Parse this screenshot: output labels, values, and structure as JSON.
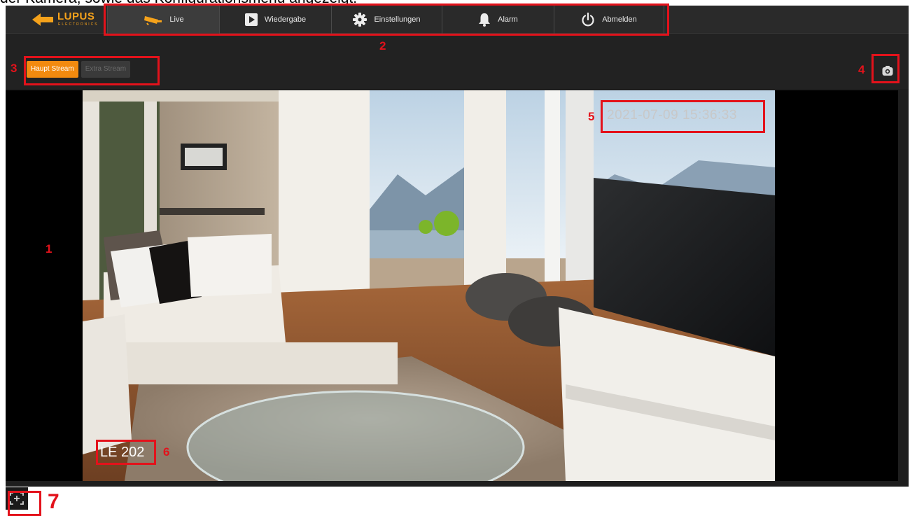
{
  "caption": "der Kamera, sowie das Konfigurationsmenü angezeigt.",
  "brand": {
    "name": "LUPUS",
    "tagline": "ELECTRONICS"
  },
  "nav": {
    "items": [
      {
        "label": "Live",
        "icon": "cctv-camera-icon",
        "active": true
      },
      {
        "label": "Wiedergabe",
        "icon": "play-icon"
      },
      {
        "label": "Einstellungen",
        "icon": "gear-icon"
      },
      {
        "label": "Alarm",
        "icon": "bell-icon"
      },
      {
        "label": "Abmelden",
        "icon": "power-icon"
      }
    ]
  },
  "streams": {
    "main": "Haupt Stream",
    "extra": "Extra Stream",
    "selected": "Haupt Stream"
  },
  "snapshot": {
    "icon": "camera-icon"
  },
  "video": {
    "timestamp": "2021-07-09 15:36:33",
    "camera_name": "LE 202"
  },
  "fullscreen": {
    "icon": "fullscreen-icon"
  },
  "annotations": [
    "1",
    "2",
    "3",
    "4",
    "5",
    "6",
    "7"
  ],
  "colors": {
    "accent": "#f28a0f",
    "annotation": "#e3121b",
    "background": "#1e1e1e"
  }
}
